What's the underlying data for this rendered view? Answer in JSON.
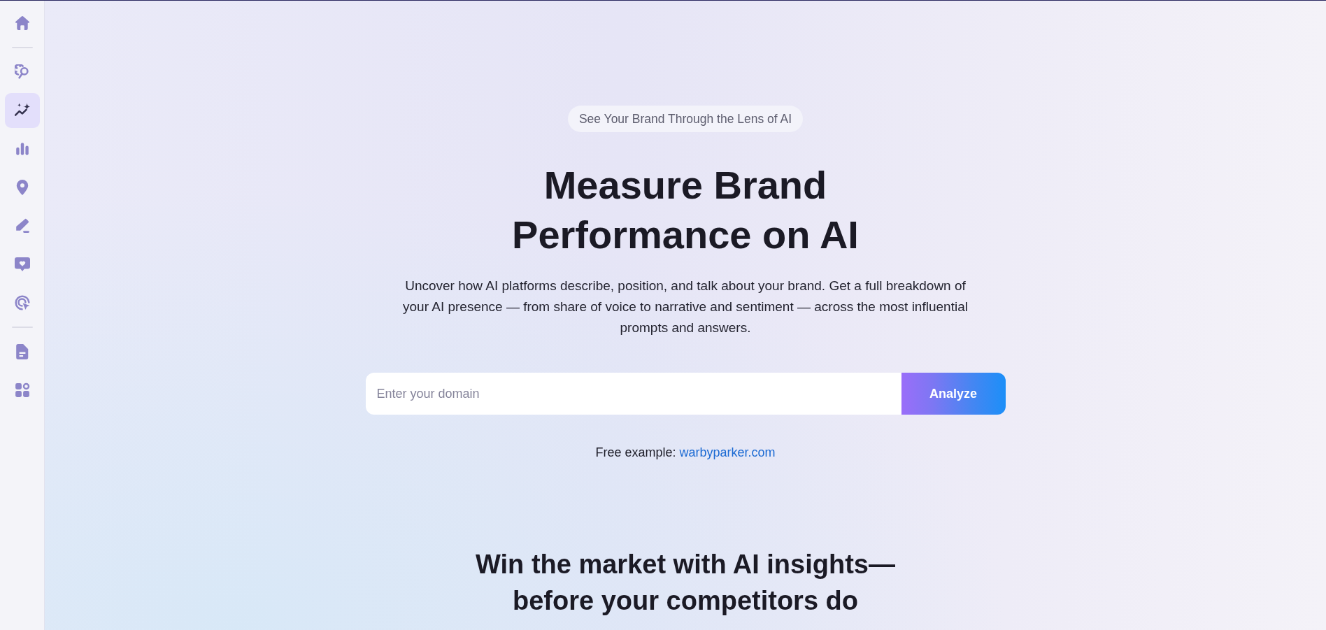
{
  "sidebar": {
    "groups": [
      {
        "items": [
          {
            "selected": false
          }
        ]
      },
      {
        "items": [
          {
            "selected": false
          },
          {
            "selected": true
          },
          {
            "selected": false
          },
          {
            "selected": false
          },
          {
            "selected": false
          },
          {
            "selected": false
          },
          {
            "selected": false
          }
        ]
      },
      {
        "items": [
          {
            "selected": false
          },
          {
            "selected": false
          }
        ]
      }
    ]
  },
  "hero": {
    "badge": "See Your Brand Through the Lens of AI",
    "title": "Measure Brand Performance on AI",
    "subtitle": "Uncover how AI platforms describe, position, and talk about your brand. Get a full breakdown of your AI presence — from share of voice to narrative and sentiment — across the most influential prompts and answers.",
    "domain_input": {
      "placeholder": "Enter your domain"
    },
    "analyze_button": "Analyze",
    "example": {
      "text": "Free example:",
      "link": "warbyparker.com"
    }
  },
  "section": {
    "title": "Win the market with AI insights—before your competitors do"
  }
}
